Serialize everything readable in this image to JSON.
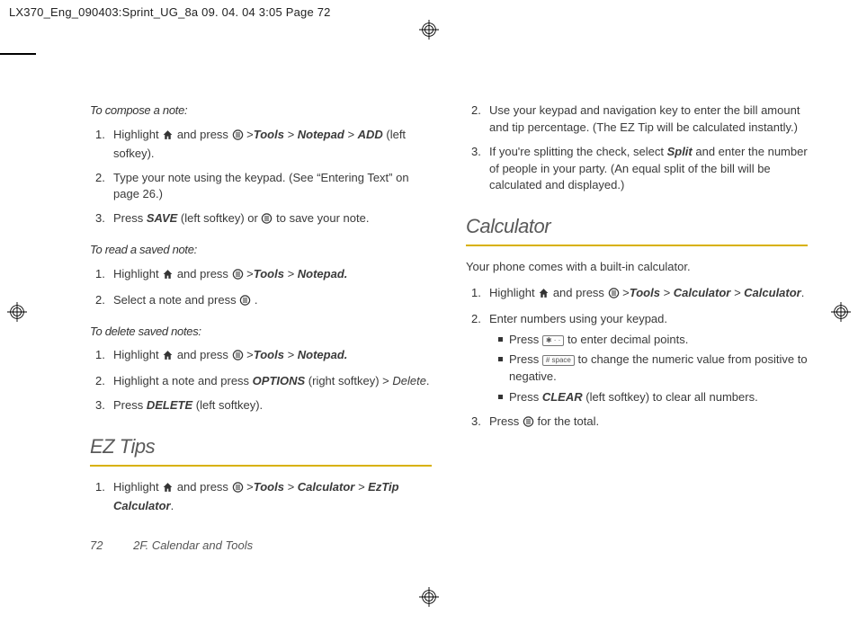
{
  "header": "LX370_Eng_090403:Sprint_UG_8a  09. 04. 04    3:05  Page 72",
  "leftCol": {
    "compose": {
      "title": "To compose a note:",
      "s1a": "Highlight ",
      "s1b": " and press ",
      "s1c": " >",
      "s1_tools": "Tools",
      "s1_gt": " > ",
      "s1_notepad": "Notepad",
      "s1_add": "ADD",
      "s1d": " (left sofkey).",
      "s2": "Type your note using the keypad. (See “Entering Text” on page 26.)",
      "s3a": "Press ",
      "s3_save": "SAVE",
      "s3b": " (left softkey) or ",
      "s3c": " to save your note."
    },
    "read": {
      "title": "To read a saved note:",
      "s1a": "Highlight ",
      "s1b": " and press ",
      "s1c": " >",
      "s1_tools": "Tools",
      "s1_gt": " > ",
      "s1_notepad": "Notepad.",
      "s2a": "Select a note and press ",
      "s2b": " ."
    },
    "del": {
      "title": "To delete saved notes:",
      "s1a": "Highlight ",
      "s1b": " and press ",
      "s1c": " >",
      "s1_tools": "Tools",
      "s1_gt": " > ",
      "s1_notepad": "Notepad.",
      "s2a": "Highlight a note and press ",
      "s2_opt": "OPTIONS",
      "s2b": " (right softkey) > ",
      "s2_del": "Delete",
      "s2c": ".",
      "s3a": "Press ",
      "s3_del": "DELETE",
      "s3b": " (left softkey)."
    },
    "ez": {
      "heading": "EZ Tips",
      "s1a": "Highlight ",
      "s1b": " and press ",
      "s1c": " >",
      "s1_tools": "Tools",
      "s1_gt": " > ",
      "s1_calc": "Calculator",
      "s1_gt2": " > ",
      "s1_eztip": "EzTip Calculator",
      "s1d": "."
    }
  },
  "rightCol": {
    "cont": {
      "s2": "Use your keypad and navigation key to enter the bill amount and tip percentage. (The EZ Tip will be calculated instantly.)",
      "s3a": "If you're splitting the check, select ",
      "s3_split": "Split",
      "s3b": " and enter the number of people in your party. (An equal split of the bill will be calculated and displayed.)"
    },
    "calc": {
      "heading": "Calculator",
      "intro": "Your phone comes with a built-in calculator.",
      "s1a": "Highlight ",
      "s1b": " and press ",
      "s1c": " >",
      "s1_tools": "Tools",
      "s1_gt": " > ",
      "s1_calc": "Calculator",
      "s1_gt2": " > ",
      "s1_calc2": "Calculator",
      "s1d": ".",
      "s2": "Enter numbers using your keypad.",
      "b1a": "Press ",
      "b1_key": "✱ · ·",
      "b1b": " to enter decimal points.",
      "b2a": "Press ",
      "b2_key": "# space",
      "b2b": " to change the numeric value from positive to negative.",
      "b3a": "Press ",
      "b3_clear": "CLEAR",
      "b3b": " (left softkey) to clear all numbers.",
      "s3a": "Press ",
      "s3b": " for the total."
    }
  },
  "footer": {
    "page": "72",
    "section": "2F. Calendar and Tools"
  }
}
